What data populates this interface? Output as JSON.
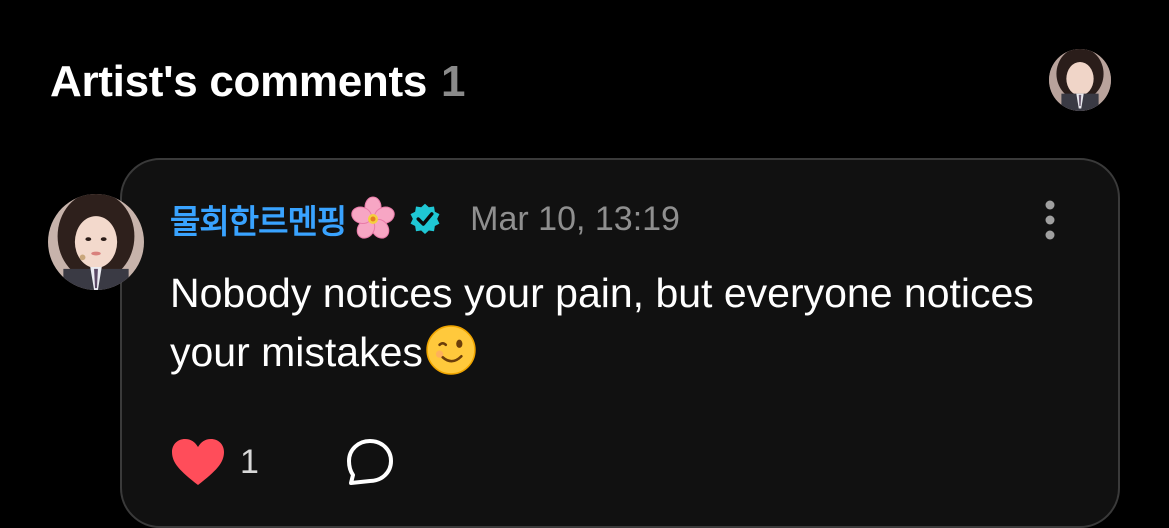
{
  "section": {
    "title": "Artist's comments",
    "count": "1"
  },
  "header": {
    "avatar_icon": "profile-avatar"
  },
  "comment": {
    "author": "물회한르멘핑",
    "author_emoji": "cherry-blossom-emoji",
    "verified_icon": "verified-badge-icon",
    "timestamp": "Mar 10, 13:19",
    "text": "Nobody notices your pain, but everyone notices your mistakes",
    "text_emoji": "winking-face-emoji",
    "like_count": "1",
    "like_icon": "heart-icon",
    "reply_icon": "comment-bubble-icon",
    "more_icon": "vertical-ellipsis-icon"
  },
  "colors": {
    "background": "#000000",
    "card_background": "#111111",
    "card_border": "#3a3a3a",
    "author_name": "#39a3ff",
    "verified_badge": "#1fc7d4",
    "heart": "#ff4d5a",
    "timestamp": "#8f8f8f",
    "count_gray": "#8a8a8a"
  }
}
